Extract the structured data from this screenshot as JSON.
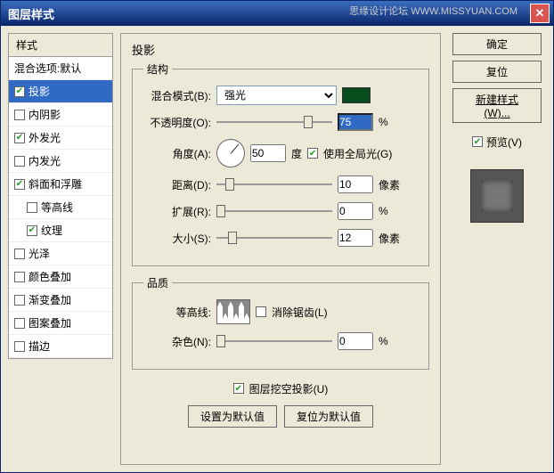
{
  "window": {
    "title": "图层样式"
  },
  "watermark": "思缘设计论坛 WWW.MISSYUAN.COM",
  "sidebar": {
    "header": "样式",
    "blend_options": "混合选项:默认",
    "items": [
      {
        "label": "投影",
        "checked": true,
        "selected": true
      },
      {
        "label": "内阴影",
        "checked": false
      },
      {
        "label": "外发光",
        "checked": true
      },
      {
        "label": "内发光",
        "checked": false
      },
      {
        "label": "斜面和浮雕",
        "checked": true
      },
      {
        "label": "等高线",
        "checked": false,
        "indent": true
      },
      {
        "label": "纹理",
        "checked": true,
        "indent": true
      },
      {
        "label": "光泽",
        "checked": false
      },
      {
        "label": "颜色叠加",
        "checked": false
      },
      {
        "label": "渐变叠加",
        "checked": false
      },
      {
        "label": "图案叠加",
        "checked": false
      },
      {
        "label": "描边",
        "checked": false
      }
    ]
  },
  "main": {
    "panel_title": "投影",
    "group_structure": "结构",
    "blend_mode_label": "混合模式(B):",
    "blend_mode_value": "强光",
    "opacity_label": "不透明度(O):",
    "opacity_value": "75",
    "percent": "%",
    "angle_label": "角度(A):",
    "angle_value": "50",
    "degree": "度",
    "use_global_light": "使用全局光(G)",
    "distance_label": "距离(D):",
    "distance_value": "10",
    "px": "像素",
    "spread_label": "扩展(R):",
    "spread_value": "0",
    "size_label": "大小(S):",
    "size_value": "12",
    "group_quality": "品质",
    "contour_label": "等高线:",
    "antialias_label": "消除锯齿(L)",
    "noise_label": "杂色(N):",
    "noise_value": "0",
    "knockout_label": "图层挖空投影(U)",
    "btn_default": "设置为默认值",
    "btn_reset": "复位为默认值",
    "shadow_color": "#064d1e"
  },
  "right": {
    "ok": "确定",
    "cancel": "复位",
    "new_style": "新建样式(W)...",
    "preview": "预览(V)"
  }
}
